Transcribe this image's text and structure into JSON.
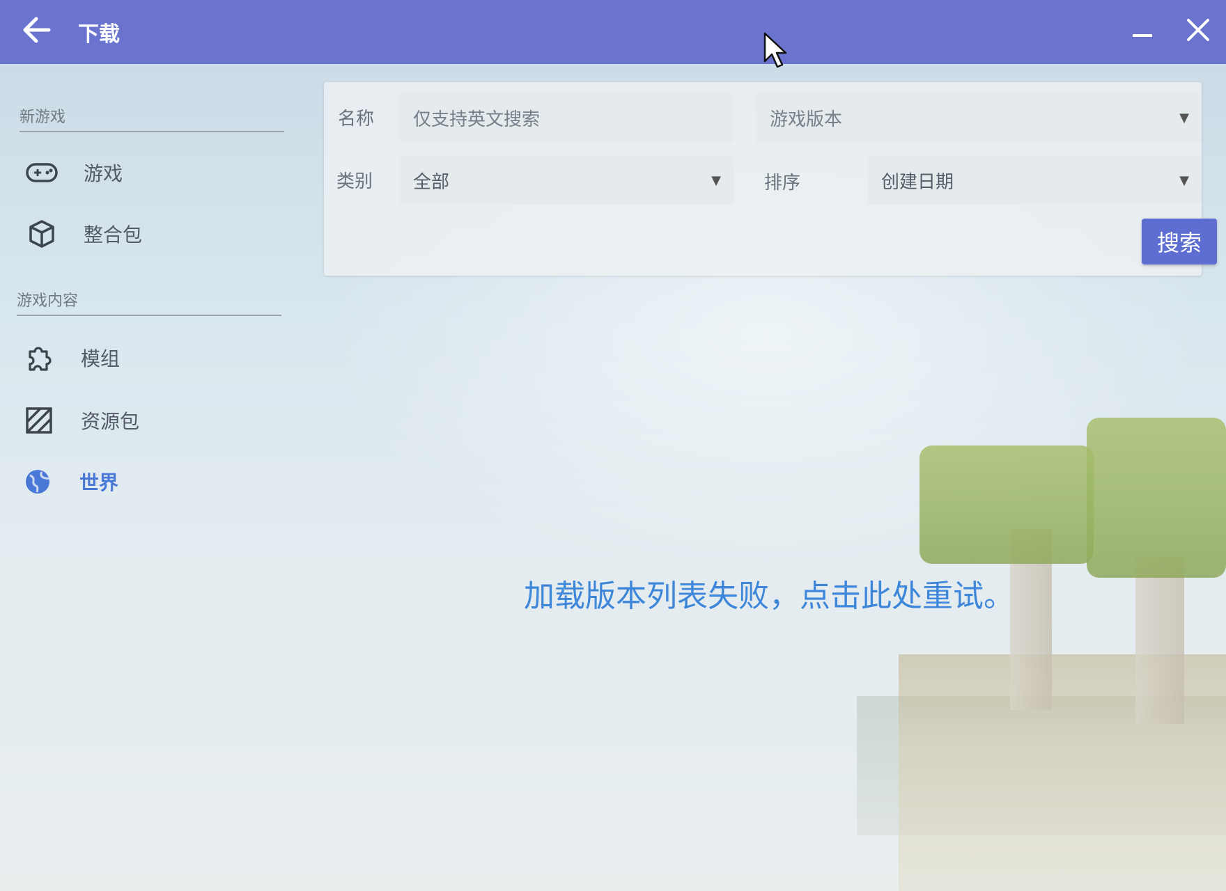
{
  "window": {
    "title": "下载",
    "back_icon": "arrow-left-icon",
    "minimize_icon": "minimize-icon",
    "close_icon": "close-icon",
    "titlebar_color": "#6a74cf"
  },
  "sidebar": {
    "sections": [
      {
        "heading": "新游戏",
        "items": [
          {
            "label": "游戏",
            "icon": "gamepad-icon"
          },
          {
            "label": "整合包",
            "icon": "cube-icon"
          }
        ]
      },
      {
        "heading": "游戏内容",
        "items": [
          {
            "label": "模组",
            "icon": "puzzle-icon"
          },
          {
            "label": "资源包",
            "icon": "texture-icon"
          },
          {
            "label": "世界",
            "icon": "globe-icon",
            "active": true
          }
        ]
      }
    ]
  },
  "search": {
    "name_label": "名称",
    "name_placeholder": "仅支持英文搜索",
    "version_placeholder": "游戏版本",
    "category_label": "类别",
    "category_value": "全部",
    "sort_label": "排序",
    "sort_value": "创建日期",
    "search_button": "搜索",
    "accent_color": "#5d6ed0"
  },
  "status": {
    "error_message": "加载版本列表失败，点击此处重试。",
    "error_color": "#3d86d9"
  }
}
